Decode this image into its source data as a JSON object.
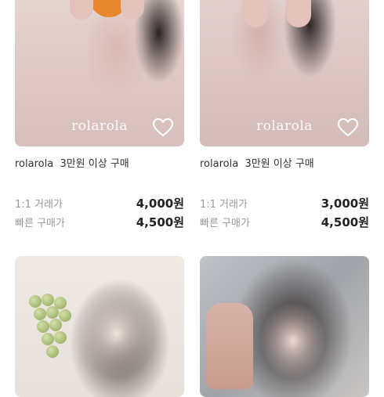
{
  "products": [
    {
      "brand": "rolarola",
      "condition": "3만원 이상 구매",
      "watermark": "rolarola",
      "price_rows": [
        {
          "label": "1:1 거래가",
          "value": "4,000원"
        },
        {
          "label": "빠른 구매가",
          "value": "4,500원"
        }
      ]
    },
    {
      "brand": "rolarola",
      "condition": "3만원 이상 구매",
      "watermark": "rolarola",
      "price_rows": [
        {
          "label": "1:1 거래가",
          "value": "3,000원"
        },
        {
          "label": "빠른 구매가",
          "value": "4,500원"
        }
      ]
    },
    {
      "brand": "",
      "condition": "",
      "watermark": "",
      "price_rows": []
    },
    {
      "brand": "",
      "condition": "",
      "watermark": "",
      "price_rows": []
    }
  ],
  "icons": {
    "favorite": "heart-outline-icon"
  }
}
